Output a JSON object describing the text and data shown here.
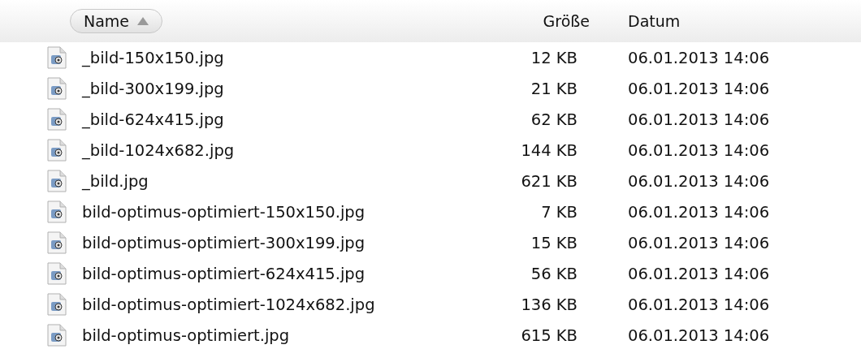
{
  "columns": [
    {
      "label": "Name",
      "selected": true
    },
    {
      "label": "Größe",
      "selected": false
    },
    {
      "label": "Datum",
      "selected": false
    }
  ],
  "rows": [
    {
      "name": "_bild-150x150.jpg",
      "size": "12 KB",
      "date": "06.01.2013 14:06"
    },
    {
      "name": "_bild-300x199.jpg",
      "size": "21 KB",
      "date": "06.01.2013 14:06"
    },
    {
      "name": "_bild-624x415.jpg",
      "size": "62 KB",
      "date": "06.01.2013 14:06"
    },
    {
      "name": "_bild-1024x682.jpg",
      "size": "144 KB",
      "date": "06.01.2013 14:06"
    },
    {
      "name": "_bild.jpg",
      "size": "621 KB",
      "date": "06.01.2013 14:06"
    },
    {
      "name": "bild-optimus-optimiert-150x150.jpg",
      "size": "7 KB",
      "date": "06.01.2013 14:06"
    },
    {
      "name": "bild-optimus-optimiert-300x199.jpg",
      "size": "15 KB",
      "date": "06.01.2013 14:06"
    },
    {
      "name": "bild-optimus-optimiert-624x415.jpg",
      "size": "56 KB",
      "date": "06.01.2013 14:06"
    },
    {
      "name": "bild-optimus-optimiert-1024x682.jpg",
      "size": "136 KB",
      "date": "06.01.2013 14:06"
    },
    {
      "name": "bild-optimus-optimiert.jpg",
      "size": "615 KB",
      "date": "06.01.2013 14:06"
    }
  ]
}
